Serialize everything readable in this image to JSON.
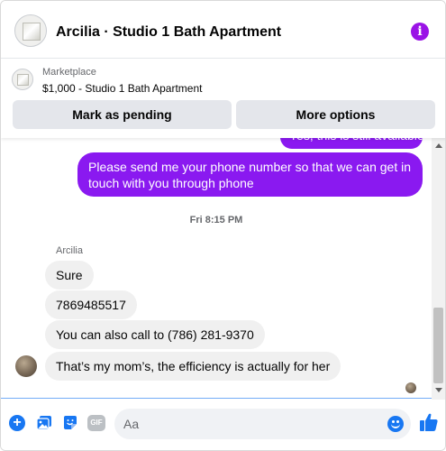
{
  "header": {
    "title": "Arcilia · Studio 1 Bath Apartment",
    "info_glyph": "i"
  },
  "marketplace": {
    "label": "Marketplace",
    "item": "$1,000 - Studio 1 Bath Apartment",
    "pending_button": "Mark as pending",
    "more_button": "More options"
  },
  "messages": {
    "partial_outgoing": "Yes, this is still available",
    "outgoing": "Please send me your phone  number so that we can get in touch with you through phone",
    "timestamp": "Fri 8:15 PM",
    "sender": "Arcilia",
    "incoming": [
      "Sure",
      "7869485517",
      "You can also call to (786) 281-9370",
      "That’s my mom’s, the efficiency is actually for her"
    ]
  },
  "composer": {
    "placeholder": "Aa",
    "plus_glyph": "+",
    "gif_label": "GIF"
  },
  "colors": {
    "accent": "#8a19f0",
    "info": "#9a13e6",
    "blue": "#1877f2"
  },
  "icons": [
    "info-icon",
    "plus-icon",
    "photo-icon",
    "sticker-icon",
    "gif-icon",
    "emoji-icon",
    "like-icon"
  ]
}
